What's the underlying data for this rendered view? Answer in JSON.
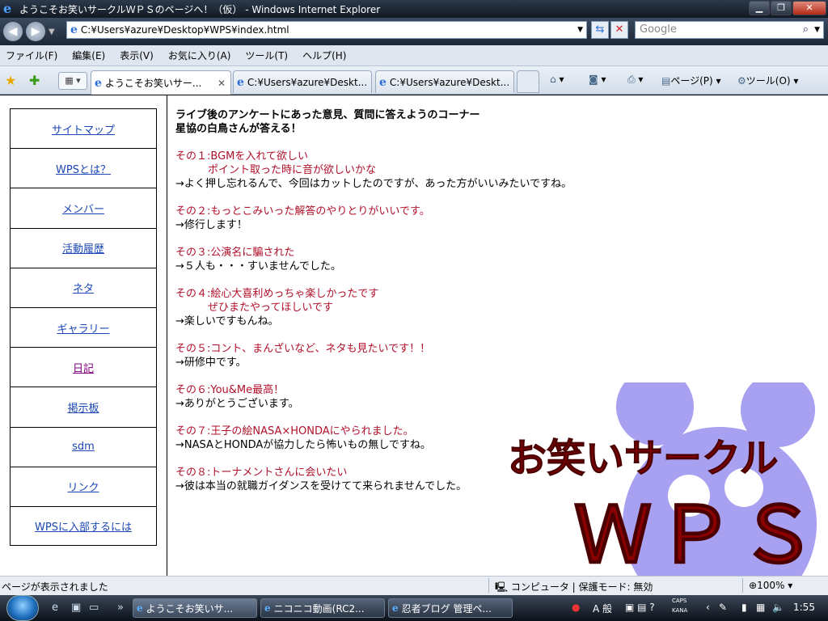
{
  "window": {
    "title": "ようこそお笑いサークルＷＰＳのページへ！（仮） - Windows Internet Explorer",
    "controls": {
      "minimize": "▁",
      "restore": "❐",
      "close": "✕"
    }
  },
  "address_bar": {
    "url": "C:¥Users¥azure¥Desktop¥WPS¥index.html",
    "search_placeholder": "Google"
  },
  "menu": [
    "ファイル(F)",
    "編集(E)",
    "表示(V)",
    "お気に入り(A)",
    "ツール(T)",
    "ヘルプ(H)"
  ],
  "tabs": [
    {
      "label": "ようこそお笑いサー...",
      "active": true
    },
    {
      "label": "C:¥Users¥azure¥Deskt...",
      "active": false
    },
    {
      "label": "C:¥Users¥azure¥Deskt...",
      "active": false
    }
  ],
  "command_bar": {
    "page": "ページ(P)",
    "tools": "ツール(O)"
  },
  "sidebar": {
    "items": [
      {
        "label": "サイトマップ"
      },
      {
        "label": "WPSとは？"
      },
      {
        "label": "メンバー"
      },
      {
        "label": "活動履歴"
      },
      {
        "label": "ネタ"
      },
      {
        "label": "ギャラリー"
      },
      {
        "label": "日記",
        "visited": true
      },
      {
        "label": "掲示板"
      },
      {
        "label": "sdm"
      },
      {
        "label": "リンク"
      },
      {
        "label": "WPSに入部するには"
      }
    ]
  },
  "main": {
    "intro_line1": "ライブ後のアンケートにあった意見、質問に答えようのコーナー",
    "intro_line2": "星協の白鳥さんが答える！",
    "qa": [
      {
        "q": "その１:BGMを入れて欲しい",
        "q2": "ポイント取った時に音が欲しいかな",
        "a": "→よく押し忘れるんで、今回はカットしたのですが、あった方がいいみたいですね。"
      },
      {
        "q": "その２:もっとこみいった解答のやりとりがいいです。",
        "a": "→修行します！"
      },
      {
        "q": "その３:公演名に騙された",
        "a": "→５人も・・・すいませんでした。"
      },
      {
        "q": "その４:絵心大喜利めっちゃ楽しかったです",
        "q2": "ぜひまたやってほしいです",
        "a": "→楽しいですもんね。"
      },
      {
        "q": "その５:コント、まんざいなど、ネタも見たいです！！",
        "a": "→研修中です。"
      },
      {
        "q": "その６:You&Me最高！",
        "a": "→ありがとうございます。"
      },
      {
        "q": "その７:王子の絵NASA×HONDAにやられました。",
        "a": "→NASAとHONDAが協力したら怖いもの無しですね。"
      },
      {
        "q": "その８:トーナメントさんに会いたい",
        "a": "→彼は本当の就職ガイダンスを受けてて来られませんでした。"
      }
    ]
  },
  "logo": {
    "line1": "お笑いサークル",
    "line2": "ＷＰＳ",
    "colors": {
      "text": "#8b0000",
      "mouse": "#a8a0f0"
    }
  },
  "statusbar": {
    "message": "ページが表示されました",
    "zone": "コンピュータ | 保護モード: 無効",
    "zoom": "100%"
  },
  "taskbar": {
    "tasks": [
      {
        "label": "ようこそお笑いサ..."
      },
      {
        "label": "ニコニコ動画(RC2..."
      },
      {
        "label": "忍者ブログ 管理ペ..."
      }
    ],
    "ime": "A 般",
    "caps": "CAPS",
    "kana": "KANA",
    "clock": "1:55"
  }
}
